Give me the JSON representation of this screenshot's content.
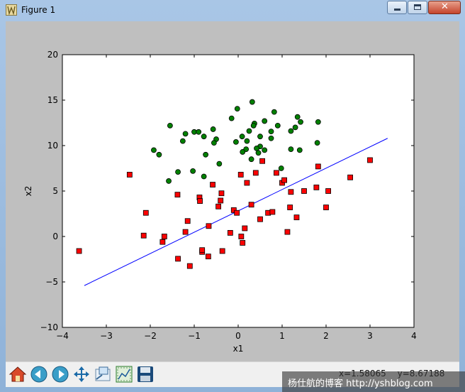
{
  "window": {
    "title": "Figure 1",
    "minimize_icon": "minimize-icon",
    "maximize_icon": "maximize-icon",
    "close_icon": "close-icon"
  },
  "toolbar": {
    "buttons": [
      {
        "icon": "home-icon"
      },
      {
        "icon": "back-arrow-icon"
      },
      {
        "icon": "forward-arrow-icon"
      },
      {
        "icon": "pan-icon"
      },
      {
        "icon": "zoom-rect-icon"
      },
      {
        "icon": "subplots-icon"
      },
      {
        "icon": "save-icon"
      }
    ],
    "coords": {
      "x": "x=1.58065",
      "y": "y=8.67188"
    }
  },
  "watermark": "杨仕航的博客 http://yshblog.com",
  "chart_data": {
    "type": "scatter",
    "xlabel": "x1",
    "ylabel": "x2",
    "xlim": [
      -4,
      4
    ],
    "ylim": [
      -10,
      20
    ],
    "xticks": [
      "−4",
      "−3",
      "−2",
      "−1",
      "0",
      "1",
      "2",
      "3",
      "4"
    ],
    "yticks": [
      "−10",
      "−5",
      "0",
      "5",
      "10",
      "15",
      "20"
    ],
    "grid": false,
    "colors": {
      "class1": "#008000",
      "class0": "#ff0000",
      "boundary": "#0000ff"
    },
    "series": [
      {
        "marker": "circle",
        "points": [
          [
            -0.02,
            14.05
          ],
          [
            0.32,
            14.8
          ],
          [
            0.37,
            12.43
          ],
          [
            0.25,
            11.6
          ],
          [
            0.5,
            11.0
          ],
          [
            0.6,
            12.7
          ],
          [
            0.82,
            13.7
          ],
          [
            0.75,
            11.55
          ],
          [
            1.35,
            13.15
          ],
          [
            1.42,
            12.6
          ],
          [
            1.3,
            12.0
          ],
          [
            1.2,
            11.6
          ],
          [
            0.18,
            9.6
          ],
          [
            0.46,
            9.2
          ],
          [
            0.5,
            9.9
          ],
          [
            0.6,
            9.5
          ],
          [
            0.75,
            10.8
          ],
          [
            -0.15,
            13.0
          ],
          [
            0.09,
            11.0
          ],
          [
            -0.05,
            10.4
          ],
          [
            0.9,
            12.2
          ],
          [
            1.2,
            9.6
          ],
          [
            1.4,
            9.5
          ],
          [
            1.82,
            12.6
          ],
          [
            1.8,
            10.3
          ],
          [
            0.98,
            7.5
          ],
          [
            -0.5,
            10.7
          ],
          [
            -0.55,
            10.3
          ],
          [
            -0.43,
            8.0
          ],
          [
            -1.55,
            12.2
          ],
          [
            -1.2,
            11.3
          ],
          [
            -1.0,
            11.5
          ],
          [
            -0.9,
            11.5
          ],
          [
            -0.78,
            11.0
          ],
          [
            -1.26,
            10.5
          ],
          [
            -1.92,
            9.5
          ],
          [
            -1.8,
            9.0
          ],
          [
            -0.74,
            9.0
          ],
          [
            -1.03,
            7.2
          ],
          [
            -1.37,
            7.1
          ],
          [
            -0.78,
            6.6
          ],
          [
            -1.58,
            6.1
          ],
          [
            -0.57,
            11.8
          ],
          [
            0.3,
            8.5
          ],
          [
            0.1,
            9.3
          ],
          [
            0.35,
            12.2
          ],
          [
            0.2,
            10.5
          ],
          [
            0.42,
            9.7
          ]
        ]
      },
      {
        "marker": "square",
        "points": [
          [
            -3.62,
            -1.6
          ],
          [
            -2.47,
            6.8
          ],
          [
            -2.1,
            2.6
          ],
          [
            -2.15,
            0.1
          ],
          [
            -1.72,
            -0.6
          ],
          [
            -1.68,
            0.0
          ],
          [
            -1.38,
            4.6
          ],
          [
            -1.37,
            -2.45
          ],
          [
            -1.15,
            1.7
          ],
          [
            -1.1,
            -3.25
          ],
          [
            -0.88,
            4.3
          ],
          [
            -0.87,
            3.9
          ],
          [
            -0.82,
            -1.7
          ],
          [
            -0.82,
            -1.5
          ],
          [
            -0.68,
            -2.2
          ],
          [
            -0.67,
            1.15
          ],
          [
            -0.58,
            5.7
          ],
          [
            -0.45,
            3.3
          ],
          [
            -0.4,
            3.95
          ],
          [
            -0.38,
            4.75
          ],
          [
            -0.36,
            -1.6
          ],
          [
            -0.18,
            0.4
          ],
          [
            -0.1,
            2.9
          ],
          [
            -0.03,
            2.6
          ],
          [
            0.06,
            6.8
          ],
          [
            0.07,
            0.0
          ],
          [
            0.1,
            -0.7
          ],
          [
            0.15,
            0.9
          ],
          [
            0.2,
            5.9
          ],
          [
            0.3,
            3.5
          ],
          [
            0.4,
            7.0
          ],
          [
            0.5,
            1.9
          ],
          [
            0.55,
            8.3
          ],
          [
            0.68,
            2.6
          ],
          [
            0.78,
            2.7
          ],
          [
            0.87,
            7.0
          ],
          [
            1.0,
            5.9
          ],
          [
            1.05,
            6.2
          ],
          [
            1.12,
            0.5
          ],
          [
            1.18,
            3.2
          ],
          [
            1.2,
            4.9
          ],
          [
            1.33,
            2.1
          ],
          [
            1.5,
            5.0
          ],
          [
            1.78,
            5.4
          ],
          [
            1.82,
            7.7
          ],
          [
            2.0,
            3.2
          ],
          [
            2.05,
            5.0
          ],
          [
            2.55,
            6.5
          ],
          [
            3.0,
            8.4
          ],
          [
            -1.2,
            0.5
          ]
        ]
      }
    ],
    "boundary_line": [
      [
        -3.5,
        -5.4
      ],
      [
        3.4,
        10.8
      ]
    ]
  }
}
